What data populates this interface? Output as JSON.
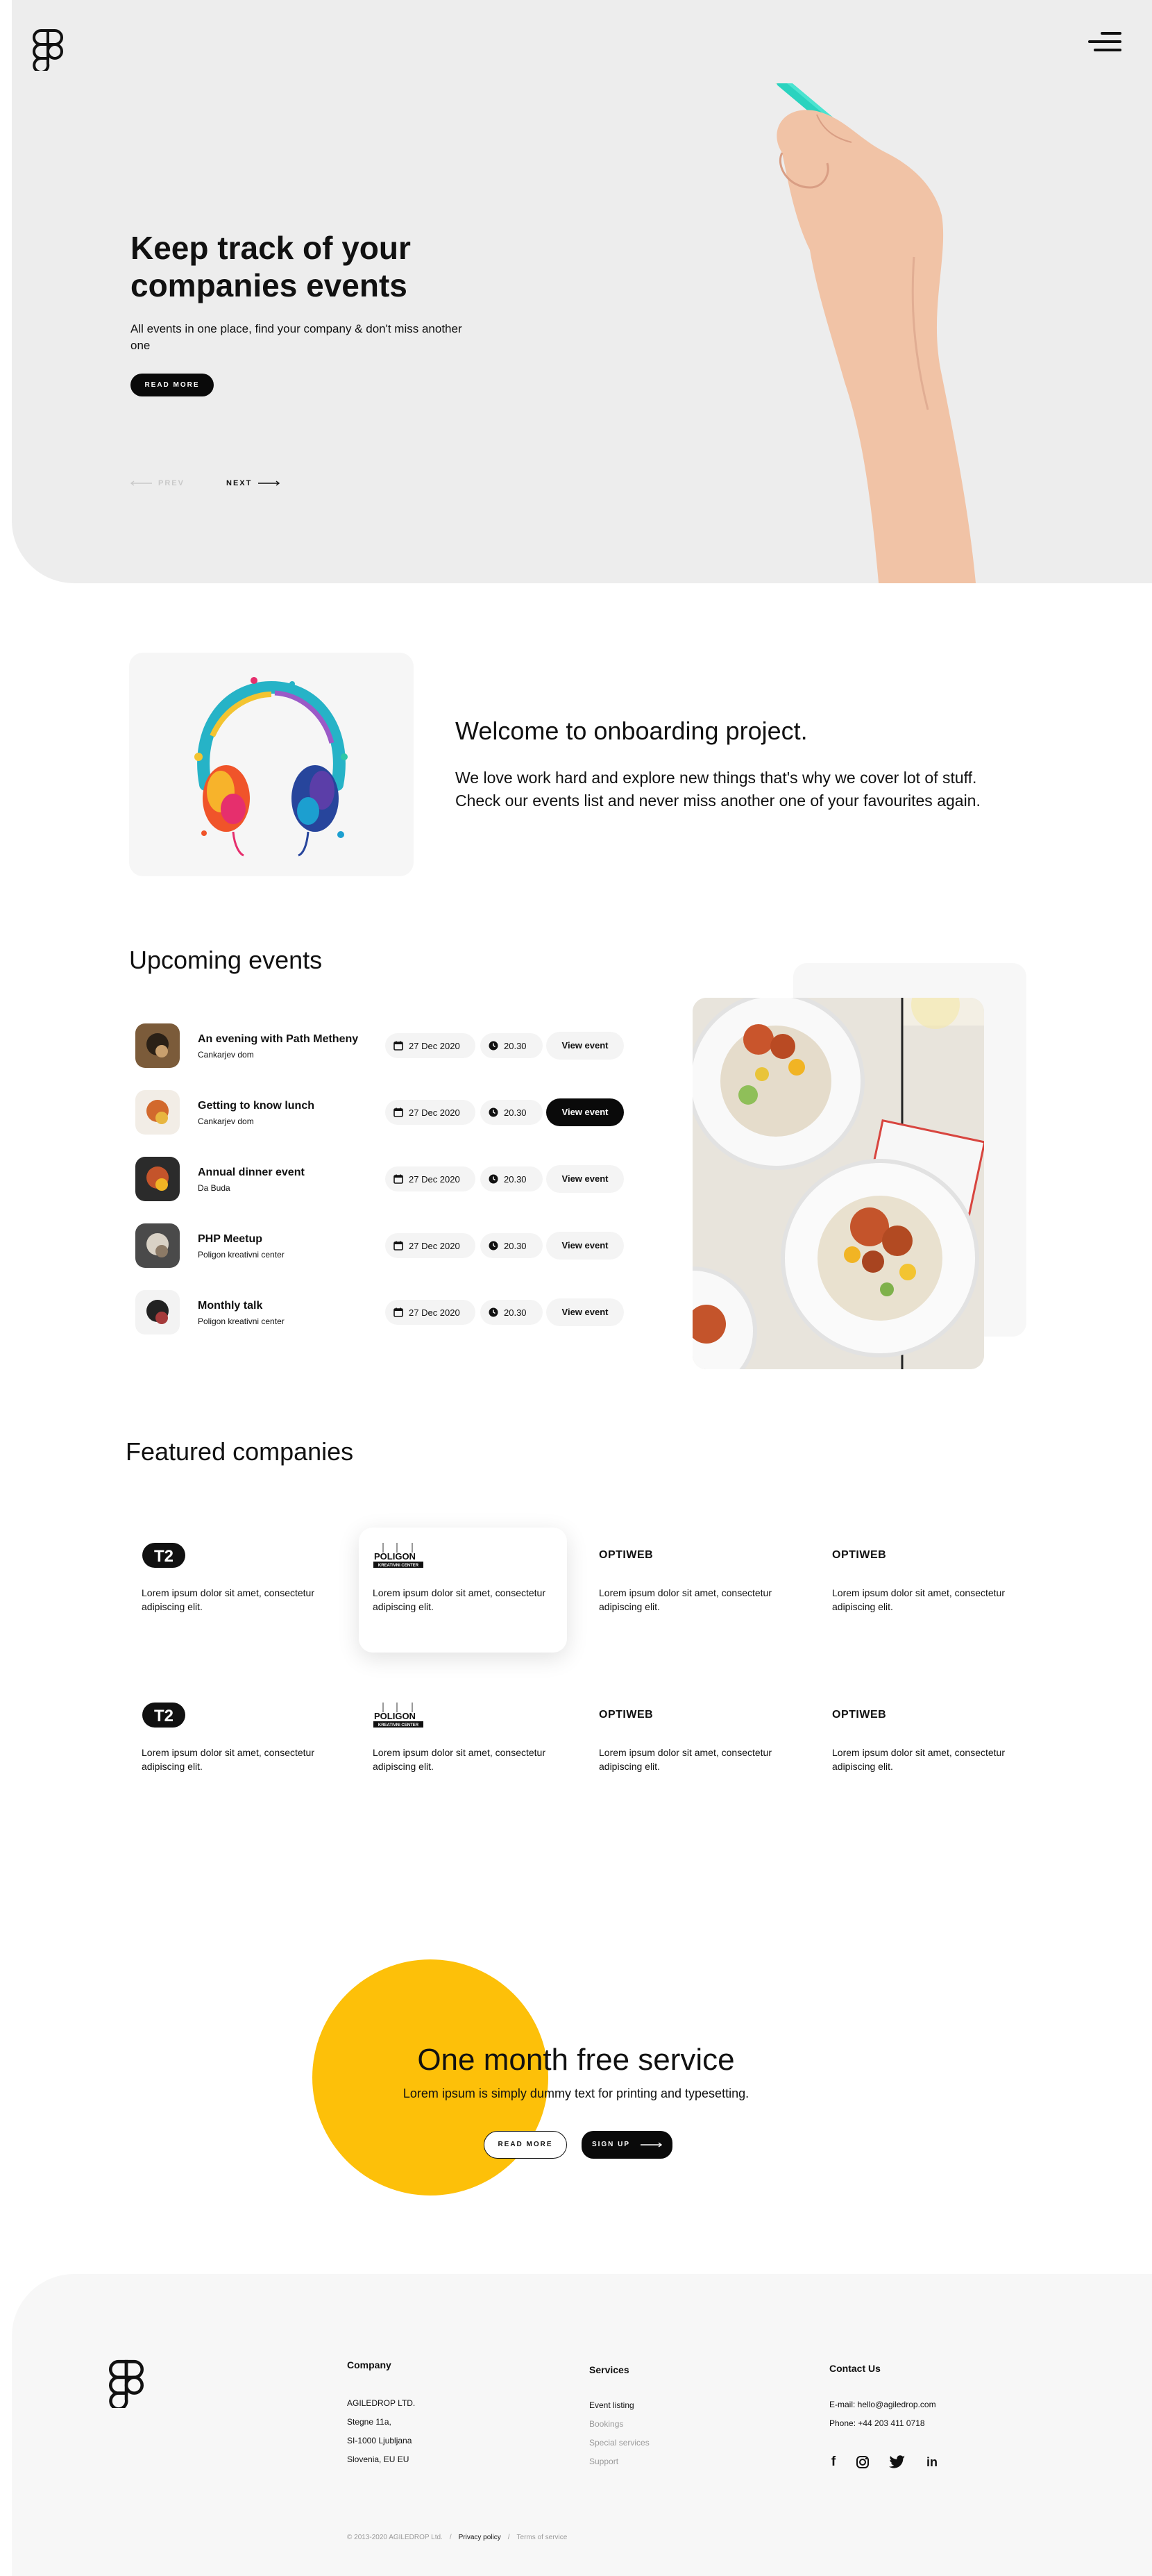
{
  "header": {
    "logo_icon": "figma-logo-icon",
    "menu_icon": "hamburger-menu-icon"
  },
  "hero": {
    "title": "Keep track of your companies events",
    "subtitle": "All events in one place, find your company & don't miss another one",
    "read_more": "READ MORE",
    "prev": "PREV",
    "next": "NEXT",
    "background": "#ededed"
  },
  "welcome": {
    "title": "Welcome to onboarding project.",
    "text": "We love work hard and explore new things that's why we cover lot of stuff. Check our events list and never miss another one of your favourites again."
  },
  "events": {
    "title": "Upcoming events",
    "items": [
      {
        "name": "An evening with Path Metheny",
        "location": "Cankarjev dom",
        "date": "27 Dec 2020",
        "time": "20.30",
        "button": "View event",
        "active": false
      },
      {
        "name": "Getting to know lunch",
        "location": "Cankarjev dom",
        "date": "27 Dec 2020",
        "time": "20.30",
        "button": "View event",
        "active": true
      },
      {
        "name": "Annual dinner event",
        "location": "Da Buda",
        "date": "27 Dec 2020",
        "time": "20.30",
        "button": "View event",
        "active": false
      },
      {
        "name": "PHP Meetup",
        "location": "Poligon kreativni center",
        "date": "27 Dec 2020",
        "time": "20.30",
        "button": "View event",
        "active": false
      },
      {
        "name": "Monthly talk",
        "location": "Poligon kreativni center",
        "date": "27 Dec 2020",
        "time": "20.30",
        "button": "View event",
        "active": false
      }
    ]
  },
  "companies": {
    "title": "Featured companies",
    "items": [
      {
        "logo": "T2",
        "text": "Lorem ipsum dolor sit amet, consectetur adipiscing elit."
      },
      {
        "logo": "POLIGON",
        "logo_sub": "KREATIVNI CENTER",
        "text": "Lorem ipsum dolor sit amet, consectetur adipiscing elit."
      },
      {
        "logo": "OPTIWEB",
        "text": "Lorem ipsum dolor sit amet, consectetur adipiscing elit."
      },
      {
        "logo": "OPTIWEB",
        "text": "Lorem ipsum dolor sit amet, consectetur adipiscing elit."
      },
      {
        "logo": "T2",
        "text": "Lorem ipsum dolor sit amet, consectetur adipiscing elit."
      },
      {
        "logo": "POLIGON",
        "logo_sub": "KREATIVNI CENTER",
        "text": "Lorem ipsum dolor sit amet, consectetur adipiscing elit."
      },
      {
        "logo": "OPTIWEB",
        "text": "Lorem ipsum dolor sit amet, consectetur adipiscing elit."
      },
      {
        "logo": "OPTIWEB",
        "text": "Lorem ipsum dolor sit amet, consectetur adipiscing elit."
      }
    ]
  },
  "promo": {
    "title": "One month free service",
    "subtitle": "Lorem ipsum is simply dummy text for printing and typesetting.",
    "read_more": "READ MORE",
    "sign_up": "SIGN UP",
    "accent": "#fdc009"
  },
  "footer": {
    "company": {
      "title": "Company",
      "lines": [
        "AGILEDROP LTD.",
        "Stegne 11a,",
        "SI-1000 Ljubljana",
        "Slovenia, EU EU"
      ]
    },
    "services": {
      "title": "Services",
      "links": [
        "Event listing",
        "Bookings",
        "Special services",
        "Support"
      ]
    },
    "contact": {
      "title": "Contact Us",
      "email": "E-mail: hello@agiledrop.com",
      "phone": "Phone: +44 203 411 0718"
    },
    "social_icons": [
      "facebook-icon",
      "instagram-icon",
      "twitter-icon",
      "linkedin-icon"
    ],
    "copyright": "© 2013-2020 AGILEDROP Ltd.",
    "privacy": "Privacy policy",
    "terms": "Terms of service",
    "separator": "/"
  }
}
